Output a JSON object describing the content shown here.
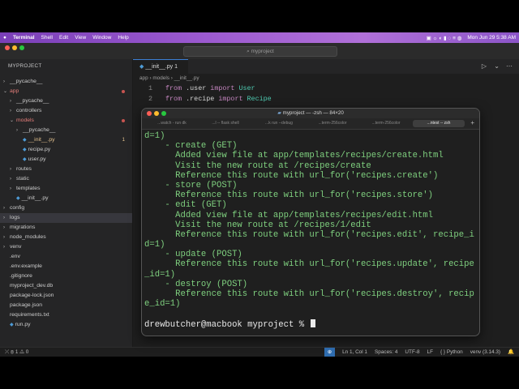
{
  "menubar": {
    "app_name": "Terminal",
    "items": [
      "Shell",
      "Edit",
      "View",
      "Window",
      "Help"
    ],
    "clock": "Mon Jun 29  5:38 AM"
  },
  "editor": {
    "search_placeholder": "myproject",
    "explorer_title": "MYPROJECT",
    "tree": [
      {
        "label": "__pycache__",
        "indent": 1,
        "chevron": "›",
        "style": ""
      },
      {
        "label": "app",
        "indent": 1,
        "chevron": "⌄",
        "style": "red",
        "dot": true
      },
      {
        "label": "__pycache__",
        "indent": 2,
        "chevron": "›",
        "style": ""
      },
      {
        "label": "controllers",
        "indent": 2,
        "chevron": "›",
        "style": ""
      },
      {
        "label": "models",
        "indent": 2,
        "chevron": "⌄",
        "style": "red",
        "dot": true
      },
      {
        "label": "__pycache__",
        "indent": 3,
        "chevron": "›",
        "style": ""
      },
      {
        "label": "__init__.py",
        "indent": 3,
        "chevron": "",
        "style": "yel",
        "py": true,
        "num": "1"
      },
      {
        "label": "recipe.py",
        "indent": 3,
        "chevron": "",
        "style": "",
        "py": true
      },
      {
        "label": "user.py",
        "indent": 3,
        "chevron": "",
        "style": "",
        "py": true
      },
      {
        "label": "routes",
        "indent": 2,
        "chevron": "›",
        "style": ""
      },
      {
        "label": "static",
        "indent": 2,
        "chevron": "›",
        "style": ""
      },
      {
        "label": "templates",
        "indent": 2,
        "chevron": "›",
        "style": ""
      },
      {
        "label": "__init__.py",
        "indent": 2,
        "chevron": "",
        "style": "",
        "py": true
      },
      {
        "label": "config",
        "indent": 1,
        "chevron": "›",
        "style": ""
      },
      {
        "label": "logs",
        "indent": 1,
        "chevron": "›",
        "style": "",
        "selected": true
      },
      {
        "label": "migrations",
        "indent": 1,
        "chevron": "›",
        "style": ""
      },
      {
        "label": "node_modules",
        "indent": 1,
        "chevron": "›",
        "style": ""
      },
      {
        "label": "venv",
        "indent": 1,
        "chevron": "›",
        "style": ""
      },
      {
        "label": ".env",
        "indent": 1,
        "chevron": "",
        "style": ""
      },
      {
        "label": ".env.example",
        "indent": 1,
        "chevron": "",
        "style": ""
      },
      {
        "label": ".gitignore",
        "indent": 1,
        "chevron": "",
        "style": ""
      },
      {
        "label": "myproject_dev.db",
        "indent": 1,
        "chevron": "",
        "style": ""
      },
      {
        "label": "package-lock.json",
        "indent": 1,
        "chevron": "",
        "style": ""
      },
      {
        "label": "package.json",
        "indent": 1,
        "chevron": "",
        "style": ""
      },
      {
        "label": "requirements.txt",
        "indent": 1,
        "chevron": "",
        "style": ""
      },
      {
        "label": "run.py",
        "indent": 1,
        "chevron": "",
        "style": "",
        "py": true
      }
    ],
    "tab_label": "__init__.py  1",
    "breadcrumb": "app  ›  models  ›  __init__.py",
    "code_lines": [
      {
        "num": "1",
        "kw": "from",
        "mod": " .user ",
        "kw2": "import",
        "cls": " User"
      },
      {
        "num": "2",
        "kw": "from",
        "mod": " .recipe ",
        "kw2": "import",
        "cls": " Recipe"
      }
    ],
    "status": {
      "problems": "⊗ 1 ⚠ 0",
      "position": "Ln 1, Col 1",
      "spaces": "Spaces: 4",
      "encoding": "UTF-8",
      "eol": "LF",
      "language": "{ }  Python",
      "env": "venv (3.14.3)"
    }
  },
  "terminal": {
    "title": "myproject — -zsh — 84×20",
    "tabs": [
      "...watch - run dk",
      "...l -- flask shell",
      "...k run --debug",
      "...term-256color",
      "...term-256color",
      "...ntest -- zsh"
    ],
    "lines": [
      "d=1)",
      "    - create (GET)",
      "      Added view file at app/templates/recipes/create.html",
      "      Visit the new route at /recipes/create",
      "      Reference this route with url_for('recipes.create')",
      "    - store (POST)",
      "      Reference this route with url_for('recipes.store')",
      "    - edit (GET)",
      "      Added view file at app/templates/recipes/edit.html",
      "      Visit the new route at /recipes/1/edit",
      "      Reference this route with url_for('recipes.edit', recipe_i",
      "d=1)",
      "    - update (POST)",
      "      Reference this route with url_for('recipes.update', recipe",
      "_id=1)",
      "    - destroy (POST)",
      "      Reference this route with url_for('recipes.destroy', recip",
      "e_id=1)",
      ""
    ],
    "prompt": "drewbutcher@macbook myproject % "
  },
  "colors": {
    "menubar_accent": "#9c5ad0",
    "terminal_text": "#7fd07f",
    "status_highlight": "#2f6db0"
  }
}
